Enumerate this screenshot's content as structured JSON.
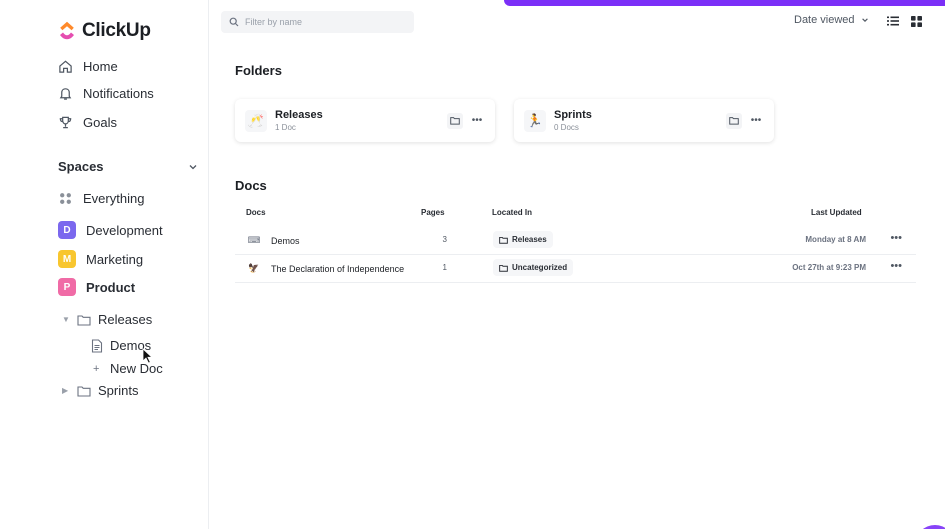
{
  "app": {
    "name": "ClickUp"
  },
  "sidebar": {
    "nav": [
      {
        "label": "Home",
        "icon": "home-icon"
      },
      {
        "label": "Notifications",
        "icon": "bell-icon"
      },
      {
        "label": "Goals",
        "icon": "trophy-icon"
      }
    ],
    "spaces_label": "Spaces",
    "everything_label": "Everything",
    "spaces": [
      {
        "initial": "D",
        "label": "Development",
        "color": "#7b68ee"
      },
      {
        "initial": "M",
        "label": "Marketing",
        "color": "#f8c62f"
      },
      {
        "initial": "P",
        "label": "Product",
        "color": "#f06ba6"
      }
    ],
    "tree": {
      "releases": "Releases",
      "demos": "Demos",
      "new_doc": "New Doc",
      "sprints": "Sprints"
    }
  },
  "toolbar": {
    "filter_placeholder": "Filter by name",
    "sort_label": "Date viewed"
  },
  "folders_title": "Folders",
  "folders": [
    {
      "name": "Releases",
      "count": "1 Doc",
      "icon": "clinking-glasses-icon"
    },
    {
      "name": "Sprints",
      "count": "0 Docs",
      "icon": "runner-icon"
    }
  ],
  "docs_title": "Docs",
  "docs_table": {
    "headers": {
      "docs": "Docs",
      "pages": "Pages",
      "located_in": "Located In",
      "last_updated": "Last Updated"
    },
    "rows": [
      {
        "name": "Demos",
        "pages": "3",
        "location": "Releases",
        "updated": "Monday at 8 AM",
        "icon": "keyboard-icon"
      },
      {
        "name": "The Declaration of Independence",
        "pages": "1",
        "location": "Uncategorized",
        "updated": "Oct 27th at 9:23 PM",
        "icon": "eagle-icon"
      }
    ]
  },
  "colors": {
    "accent": "#7b2ff7"
  }
}
